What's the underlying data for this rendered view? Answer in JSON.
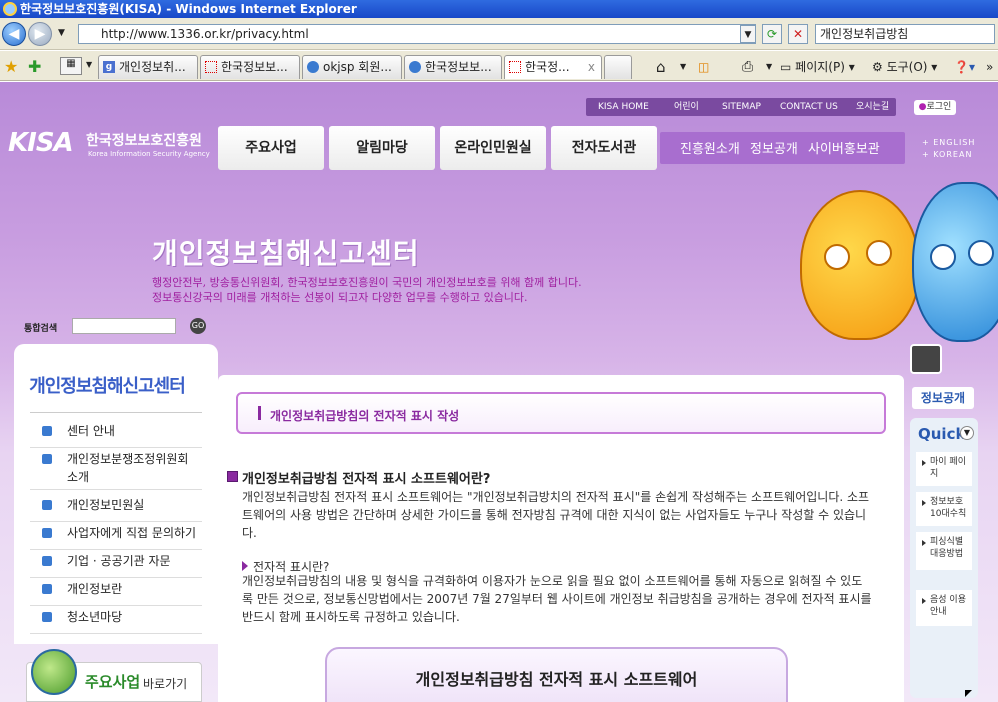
{
  "window": {
    "title": "한국정보보호진흥원(KISA) - Windows Internet Explorer"
  },
  "address": {
    "url": "http://www.1336.or.kr/privacy.html",
    "search_value": "개인정보취급방침"
  },
  "tabs": [
    {
      "label": "개인정보취..."
    },
    {
      "label": "한국정보보..."
    },
    {
      "label": "okjsp 회원..."
    },
    {
      "label": "한국정보보..."
    },
    {
      "label": "한국정..."
    }
  ],
  "commands": {
    "page": "페이지(P)",
    "tools": "도구(O)"
  },
  "site": {
    "top_links": [
      "KISA HOME",
      "어린이",
      "SITEMAP",
      "CONTACT US",
      "오시는길"
    ],
    "login": "로그인",
    "logo_text": "KISA",
    "logo_name": "한국정보보호진흥원",
    "logo_sub": "Korea Information Security Agency",
    "main_menu": [
      "주요사업",
      "알림마당",
      "온라인민원실",
      "전자도서관"
    ],
    "sub_menu": [
      "진흥원소개",
      "정보공개",
      "사이버홍보관"
    ],
    "lang": [
      "+ ENGLISH",
      "+ KOREAN"
    ],
    "hero_title": "개인정보침해신고센터",
    "hero_line1": "행정안전부, 방송통신위원회, 한국정보보호진흥원이 국민의 개인정보보호를 위해 함께 합니다.",
    "hero_line2": "정보통신강국의 미래를 개척하는 선봉이 되고자 다양한 업무를 수행하고 있습니다.",
    "search_label": "통합검색",
    "search_go": "GO"
  },
  "left": {
    "title": "개인정보침해신고센터",
    "items": [
      "센터 안내",
      "개인정보분쟁조정위원회 소개",
      "개인정보민원실",
      "사업자에게 직접 문의하기",
      "기업 · 공공기관 자문",
      "개인정보란",
      "청소년마당"
    ],
    "quick_title": "주요사업",
    "quick_sub": "바로가기"
  },
  "content": {
    "heading": "개인정보취급방침의 전자적 표시 작성",
    "sec1_title": "개인정보취급방침 전자적 표시 소프트웨어란?",
    "sec1_body": "개인정보취급방침 전자적 표시 소프트웨어는 \"개인정보취급방치의 전자적 표시\"를 손쉽게 작성해주는 소프트웨어입니다. 소프트웨어의 사용 방법은 간단하며 상세한 가이드를 통해 전자방침 규격에 대한 지식이 없는 사업자들도 누구나 작성할 수 있습니다.",
    "sec2_title": "전자적 표시란?",
    "sec2_body": "개인정보취급방침의 내용 및 형식을 규격화하여 이용자가 눈으로 읽을 필요 없이 소프트웨어를 통해 자동으로 읽혀질 수 있도록 만든 것으로, 정보통신망법에서는 2007년 7월 27일부터 웹 사이트에 개인정보 취급방침을 공개하는 경우에 전자적 표시를 반드시 함께 표시하도록 규정하고 있습니다.",
    "banner": "개인정보취급방침 전자적 표시 소프트웨어"
  },
  "right": {
    "info_tab": "정보공개",
    "quick_title": "Quick",
    "items": [
      "마이 페이지",
      "정보보호 10대수칙",
      "피싱식별 대응방법",
      "음성 이용안내"
    ]
  }
}
